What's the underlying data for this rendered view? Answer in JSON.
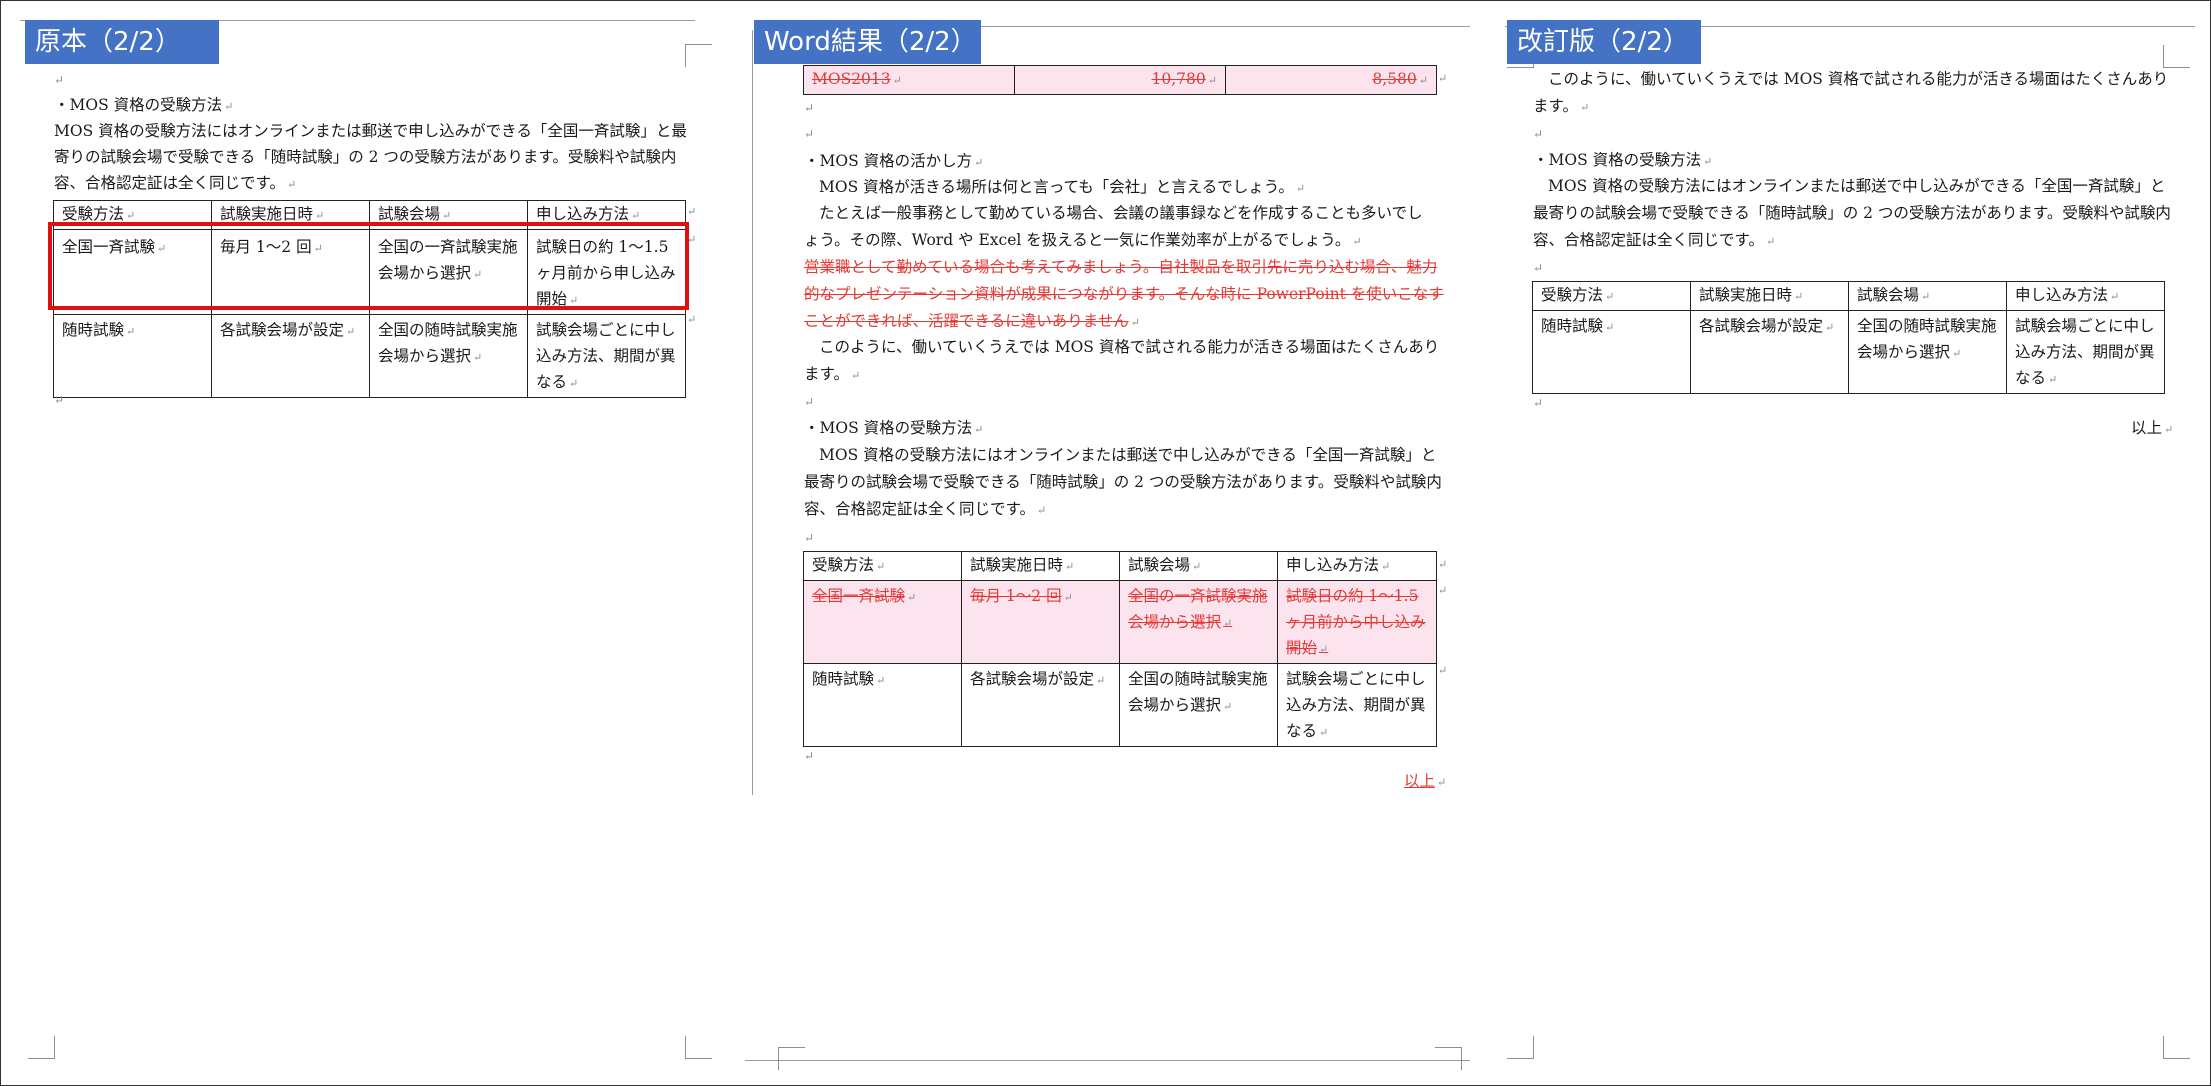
{
  "panels": {
    "original": {
      "label": "原本（2/2）",
      "heading": "・MOS 資格の受験方法",
      "body_line1": "MOS 資格の受験方法にはオンラインまたは郵送で申し込みができる「全国一斉試験」と最",
      "body_line2": "寄りの試験会場で受験できる「随時試験」の 2 つの受験方法があります。受験料や試験内",
      "body_line3": "容、合格認定証は全く同じです。",
      "table": {
        "headers": [
          "受験方法",
          "試験実施日時",
          "試験会場",
          "申し込み方法"
        ],
        "rows": [
          [
            "全国一斉試験",
            "毎月 1～2 回",
            "全国の一斉試験実施|会場から選択",
            "試験日の約 1～1.5|ヶ月前から申し込み|開始"
          ],
          [
            "随時試験",
            "各試験会場が設定",
            "全国の随時試験実施|会場から選択",
            "試験会場ごとに中し|込み方法、期間が異|なる"
          ]
        ]
      }
    },
    "word_result": {
      "label": "Word結果（2/2）",
      "top_row": [
        "MOS2013",
        "10,780",
        "8,580"
      ],
      "heading1": "・MOS 資格の活かし方",
      "p1": "MOS 資格が活きる場所は何と言っても「会社」と言えるでしょう。",
      "p2_line1": "たとえば一般事務として勤めている場合、会議の議事録などを作成することも多いでし",
      "p2_line2": "ょう。その際、Word や Excel を扱えると一気に作業効率が上がるでしょう。",
      "del_line1": "営業職として勤めている場合も考えてみましょう。自社製品を取引先に売り込む場合、魅力",
      "del_line2": "的なプレゼンテーション資料が成果につながります。そんな時に PowerPoint を使いこなす",
      "del_line3": "ことができれば、活躍できるに違いありません",
      "p3_line1": "このように、働いていくうえでは MOS 資格で試される能力が活きる場面はたくさんあり",
      "p3_line2": "ます。",
      "heading2": "・MOS 資格の受験方法",
      "p4_line1": "MOS 資格の受験方法にはオンラインまたは郵送で中し込みができる「全国一斉試験」と",
      "p4_line2": "最寄りの試験会場で受験できる「随時試験」の 2 つの受験方法があります。受験料や試験内",
      "p4_line3": "容、合格認定証は全く同じです。",
      "table": {
        "headers": [
          "受験方法",
          "試験実施日時",
          "試験会場",
          "申し込み方法"
        ],
        "rows": [
          [
            "全国一斉試験",
            "毎月 1～2 回",
            "全国の一斉試験実施|会場から選択",
            "試験日の約 1～1.5|ヶ月前から中し込み|開始"
          ],
          [
            "随時試験",
            "各試験会場が設定",
            "全国の随時試験実施|会場から選択",
            "試験会場ごとに中し|込み方法、期間が異|なる"
          ]
        ]
      },
      "end": "以上"
    },
    "revised": {
      "label": "改訂版（2/2）",
      "p1_line1": "このように、働いていくうえでは MOS 資格で試される能力が活きる場面はたくさんあり",
      "p1_line2": "ます。",
      "heading": "・MOS 資格の受験方法",
      "p2_line1": "MOS 資格の受験方法にはオンラインまたは郵送で中し込みができる「全国一斉試験」と",
      "p2_line2": "最寄りの試験会場で受験できる「随時試験」の 2 つの受験方法があります。受験料や試験内",
      "p2_line3": "容、合格認定証は全く同じです。",
      "table": {
        "headers": [
          "受験方法",
          "試験実施日時",
          "試験会場",
          "申し込み方法"
        ],
        "rows": [
          [
            "随時試験",
            "各試験会場が設定",
            "全国の随時試験実施|会場から選択",
            "試験会場ごとに中し|込み方法、期間が異|なる"
          ]
        ]
      },
      "end": "以上"
    }
  },
  "colors": {
    "label_bg": "#4472c4",
    "deletion": "#e53935",
    "deletion_bg": "#fce4ef",
    "highlight_box": "#e01010"
  }
}
